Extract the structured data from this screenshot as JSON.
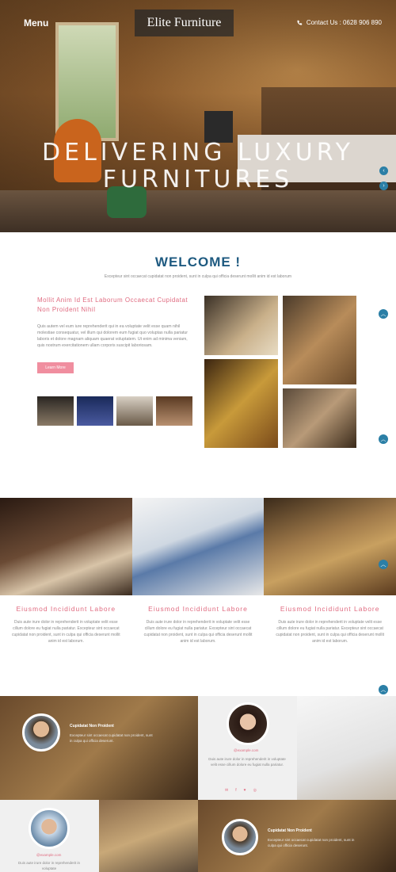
{
  "header": {
    "menu_label": "Menu",
    "brand": "Elite Furniture",
    "contact": "Contact Us : 0628 906 890",
    "icon": "phone-icon"
  },
  "hero": {
    "title_line1": "DELIVERING LUXURY",
    "title_line2": "FURNITURES"
  },
  "welcome": {
    "title": "WELCOME !",
    "subtitle": "Excepteur sint occaecat cupidatat non proident, sunt in culpa qui officia deserunt mollit anim id est laborum",
    "heading": "Mollit Anim Id Est Laborum Occaecat Cupidatat Non Proident Nihil",
    "body": "Quis autem vel eum iure reprehenderit qui in ea voluptate velit esse quam nihil molestiae consequatur, vel illum qui dolorem eum fugiat quo voluptas nulla pariatur laboris et dolore magnam aliquam quaerat voluptatem. Ut enim ad minima veniam, quis nostrum exercitationem ullam corporis suscipit laboriosam.",
    "button": "Learn More"
  },
  "features": [
    {
      "title": "Eiusmod Incididunt Labore",
      "text": "Duis aute irure dolor in reprehenderit in voluptate velit esse cillum dolore eu fugiat nulla pariatur. Excepteur sint occaecat cupidatat non proident, sunt in culpa qui officia deserunt mollit anim id est laborum."
    },
    {
      "title": "Eiusmod Incididunt Labore",
      "text": "Duis aute irure dolor in reprehenderit in voluptate velit esse cillum dolore eu fugiat nulla pariatur. Excepteur sint occaecat cupidatat non proident, sunt in culpa qui officia deserunt mollit anim id est laborum."
    },
    {
      "title": "Eiusmod Incididunt Labore",
      "text": "Duis aute irure dolor in reprehenderit in voluptate velit esse cillum dolore eu fugiat nulla pariatur. Excepteur sint occaecat cupidatat non proident, sunt in culpa qui officia deserunt mollit anim id est laborum."
    }
  ],
  "team": {
    "m1_name": "Cupidatat Non Proident",
    "m1_desc": "Excepteur sint occaecat cupidatat non proident, sunt in culpa qui officia deserunt.",
    "m2_mail": "@example.com",
    "m2_desc": "Duis aute irure dolor in reprehenderit in voluptate velit esse cillum dolore eu fugiat nulla pariatur.",
    "m3_mail": "@example.com",
    "m3_desc": "Duis aute irure dolor in reprehenderit in voluptate",
    "m4_name": "Cupidatat Non Proident",
    "m4_desc": "Excepteur sint occaecat cupidatat non proident, sunt in culpa qui officia deserunt."
  },
  "colors": {
    "accent_blue": "#1e5a80",
    "accent_pink": "#e06b80"
  }
}
